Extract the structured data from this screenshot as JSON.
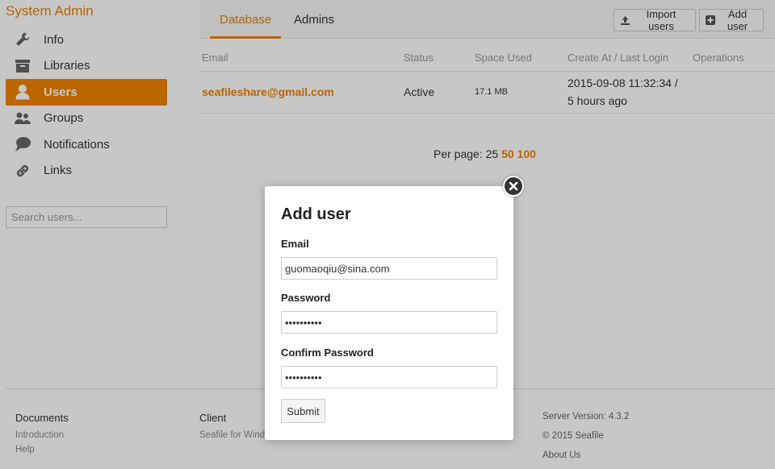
{
  "brand": "System Admin",
  "sidebar": {
    "items": [
      {
        "label": "Info",
        "icon": "wrench-icon"
      },
      {
        "label": "Libraries",
        "icon": "archive-icon"
      },
      {
        "label": "Users",
        "icon": "user-icon",
        "active": true
      },
      {
        "label": "Groups",
        "icon": "group-icon"
      },
      {
        "label": "Notifications",
        "icon": "chat-bubble-icon"
      },
      {
        "label": "Links",
        "icon": "link-icon"
      }
    ],
    "search_placeholder": "Search users..."
  },
  "tabs": [
    {
      "label": "Database",
      "active": true
    },
    {
      "label": "Admins",
      "active": false
    }
  ],
  "toolbar": {
    "import_label": "Import users",
    "add_label": "Add user"
  },
  "table": {
    "headers": [
      "Email",
      "Status",
      "Space Used",
      "Create At / Last Login",
      "Operations"
    ],
    "rows": [
      {
        "email": "seafileshare@gmail.com",
        "status": "Active",
        "space": "17.1 MB",
        "created": "2015-09-08 11:32:34 /",
        "last_login": "5 hours ago"
      }
    ]
  },
  "pagination": {
    "label": "Per page:",
    "current": "25",
    "options": [
      "50",
      "100"
    ]
  },
  "footer": {
    "documents": {
      "title": "Documents",
      "links": [
        "Introduction",
        "Help"
      ]
    },
    "client": {
      "title": "Client",
      "links": [
        "Seafile for Windows"
      ]
    },
    "server_version": "Server Version: 4.3.2",
    "copyright": "© 2015 Seafile",
    "about": "About Us"
  },
  "modal": {
    "title": "Add user",
    "email_label": "Email",
    "email_value": "guomaoqiu@sina.com",
    "password_label": "Password",
    "password_value": "••••••••••",
    "confirm_label": "Confirm Password",
    "confirm_value": "••••••••••",
    "submit_label": "Submit"
  },
  "colors": {
    "accent": "#eb8205",
    "active_nav": "#f08300"
  }
}
